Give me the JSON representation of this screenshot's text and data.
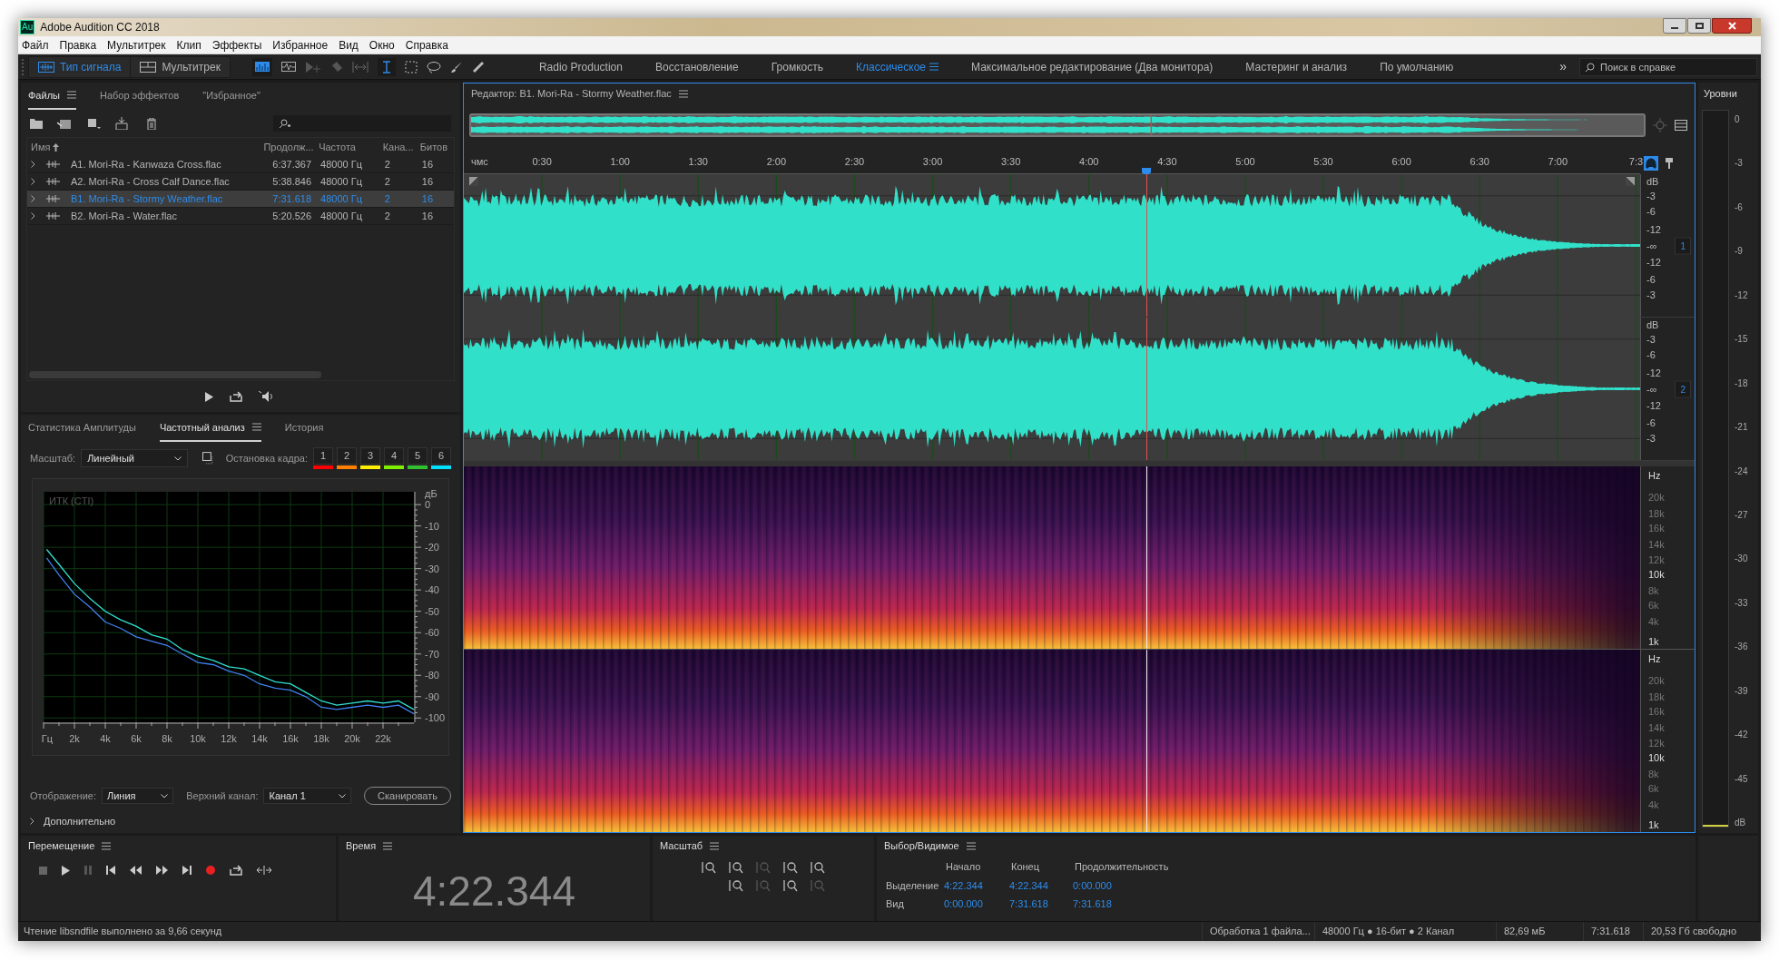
{
  "window": {
    "app_icon": "Au",
    "title": "Adobe Audition CC 2018"
  },
  "menu": [
    "Файл",
    "Правка",
    "Мультитрек",
    "Клип",
    "Эффекты",
    "Избранное",
    "Вид",
    "Окно",
    "Справка"
  ],
  "toolbar": {
    "modes": [
      {
        "label": "Тип сигнала",
        "selected": true
      },
      {
        "label": "Мультитрек",
        "selected": false
      }
    ],
    "workspaces": [
      {
        "label": "Radio Production",
        "selected": false
      },
      {
        "label": "Восстановление",
        "selected": false
      },
      {
        "label": "Громкость",
        "selected": false
      },
      {
        "label": "Классическое",
        "selected": true
      },
      {
        "label": "Максимальное редактирование (Два монитора)",
        "selected": false
      },
      {
        "label": "Мастеринг и анализ",
        "selected": false
      },
      {
        "label": "По умолчанию",
        "selected": false
      }
    ],
    "overflow": "»",
    "search": {
      "placeholder": "Поиск в справке"
    }
  },
  "files_panel": {
    "tabs": [
      {
        "label": "Файлы",
        "selected": true
      },
      {
        "label": "Набор эффектов",
        "selected": false
      },
      {
        "label": "\"Избранное\"",
        "selected": false
      }
    ],
    "columns": [
      "Имя",
      "Продолж...",
      "Частота",
      "Кана...",
      "Битов"
    ],
    "rows": [
      {
        "name": "A1. Mori-Ra - Kanwaza Cross.flac",
        "duration": "6:37.367",
        "rate": "48000 Гц",
        "channels": "2",
        "bits": "16",
        "selected": false
      },
      {
        "name": "A2. Mori-Ra - Cross Calf Dance.flac",
        "duration": "5:38.846",
        "rate": "48000 Гц",
        "channels": "2",
        "bits": "16",
        "selected": false
      },
      {
        "name": "B1. Mori-Ra - Stormy Weather.flac",
        "duration": "7:31.618",
        "rate": "48000 Гц",
        "channels": "2",
        "bits": "16",
        "selected": true
      },
      {
        "name": "B2. Mori-Ra - Water.flac",
        "duration": "5:20.526",
        "rate": "48000 Гц",
        "channels": "2",
        "bits": "16",
        "selected": false
      }
    ]
  },
  "analysis_panel": {
    "tabs": [
      {
        "label": "Статистика Амплитуды",
        "selected": false
      },
      {
        "label": "Частотный анализ",
        "selected": true
      },
      {
        "label": "История",
        "selected": false
      }
    ],
    "scale_label": "Масштаб:",
    "scale_value": "Линейный",
    "freeze_label": "Остановка кадра:",
    "freeze_slots": [
      {
        "label": "1",
        "color": "#ff0000"
      },
      {
        "label": "2",
        "color": "#ff8000"
      },
      {
        "label": "3",
        "color": "#ffee00"
      },
      {
        "label": "4",
        "color": "#80ee00"
      },
      {
        "label": "5",
        "color": "#30c030"
      },
      {
        "label": "6",
        "color": "#00e0ff"
      }
    ],
    "chart_data": {
      "type": "line",
      "title": "ИТК (CTI)",
      "ylabel": "дБ",
      "x": [
        200,
        1000,
        2000,
        3000,
        4000,
        5000,
        6000,
        7000,
        8000,
        9000,
        10000,
        11000,
        12000,
        13000,
        14000,
        15000,
        16000,
        17000,
        18000,
        19000,
        20000,
        21000,
        22000,
        23000,
        24000
      ],
      "series": [
        {
          "color": "#30e0d0",
          "values": [
            -21,
            -28,
            -37,
            -44,
            -50,
            -54,
            -57,
            -61,
            -63,
            -68,
            -71,
            -73,
            -76,
            -77,
            -80,
            -83,
            -84,
            -88,
            -92,
            -94,
            -93,
            -92,
            -93,
            -92,
            -96
          ]
        },
        {
          "color": "#4080f0",
          "values": [
            -25,
            -33,
            -42,
            -48,
            -55,
            -58,
            -62,
            -64,
            -66,
            -70,
            -74,
            -75,
            -78,
            -80,
            -84,
            -86,
            -87,
            -90,
            -95,
            -96,
            -95,
            -94,
            -95,
            -94,
            -98
          ]
        }
      ],
      "xlim": [
        0,
        24000
      ],
      "ylim": [
        -102,
        6
      ],
      "xticks": [
        {
          "value": 0,
          "label": "Гц"
        },
        {
          "value": 2000,
          "label": "2k"
        },
        {
          "value": 4000,
          "label": "4k"
        },
        {
          "value": 6000,
          "label": "6k"
        },
        {
          "value": 8000,
          "label": "8k"
        },
        {
          "value": 10000,
          "label": "10k"
        },
        {
          "value": 12000,
          "label": "12k"
        },
        {
          "value": 14000,
          "label": "14k"
        },
        {
          "value": 16000,
          "label": "16k"
        },
        {
          "value": 18000,
          "label": "18k"
        },
        {
          "value": 20000,
          "label": "20k"
        },
        {
          "value": 22000,
          "label": "22k"
        }
      ],
      "yticks": [
        0,
        -10,
        -20,
        -30,
        -40,
        -50,
        -60,
        -70,
        -80,
        -90,
        -100
      ],
      "grid": true
    },
    "display_label": "Отображение:",
    "display_value": "Линия",
    "channel_label": "Верхний канал:",
    "channel_value": "Канал 1",
    "scan_button": "Сканировать",
    "advanced": "Дополнительно"
  },
  "editor": {
    "title": "Редактор: B1. Mori-Ra - Stormy Weather.flac",
    "ruler": [
      "чмс",
      "0:30",
      "1:00",
      "1:30",
      "2:00",
      "2:30",
      "3:00",
      "3:30",
      "4:00",
      "4:30",
      "5:00",
      "5:30",
      "6:00",
      "6:30",
      "7:00",
      "7:3"
    ],
    "channels": [
      {
        "badge": "1",
        "db_scale": [
          "dB",
          "-3",
          "-6",
          "-12",
          "-∞",
          "-12",
          "-6",
          "-3"
        ]
      },
      {
        "badge": "2",
        "db_scale": [
          "dB",
          "-3",
          "-6",
          "-12",
          "-∞",
          "-12",
          "-6",
          "-3"
        ]
      }
    ],
    "spectrograms": [
      {
        "hz_scale": [
          "Hz",
          "20k",
          "18k",
          "16k",
          "14k",
          "12k",
          "10k",
          "8k",
          "6k",
          "4k",
          "1k"
        ]
      },
      {
        "hz_scale": [
          "Hz",
          "20k",
          "18k",
          "16k",
          "14k",
          "12k",
          "10k",
          "8k",
          "6k",
          "4k",
          "1k"
        ]
      }
    ]
  },
  "levels": {
    "title": "Уровни",
    "scale": [
      "0",
      "-3",
      "-6",
      "-9",
      "-12",
      "-15",
      "-18",
      "-21",
      "-24",
      "-27",
      "-30",
      "-33",
      "-36",
      "-39",
      "-42",
      "-45"
    ],
    "unit": "dB"
  },
  "transport": {
    "title": "Перемещение"
  },
  "time": {
    "title": "Время",
    "value": "4:22.344"
  },
  "zoom": {
    "title": "Масштаб"
  },
  "selection": {
    "title": "Выбор/Видимое",
    "columns": [
      "Начало",
      "Конец",
      "Продолжительность"
    ],
    "rows": [
      {
        "label": "Выделение",
        "values": [
          "4:22.344",
          "4:22.344",
          "0:00.000"
        ]
      },
      {
        "label": "Вид",
        "values": [
          "0:00.000",
          "7:31.618",
          "7:31.618"
        ]
      }
    ]
  },
  "status_bar": {
    "message": "Чтение libsndfile выполнено за 9,66 секунд",
    "items": [
      "Обработка 1 файла...",
      "48000 Гц ● 16-бит ● 2 Канал",
      "82,69 мБ",
      "7:31.618",
      "20,53 Гб свободно"
    ]
  }
}
